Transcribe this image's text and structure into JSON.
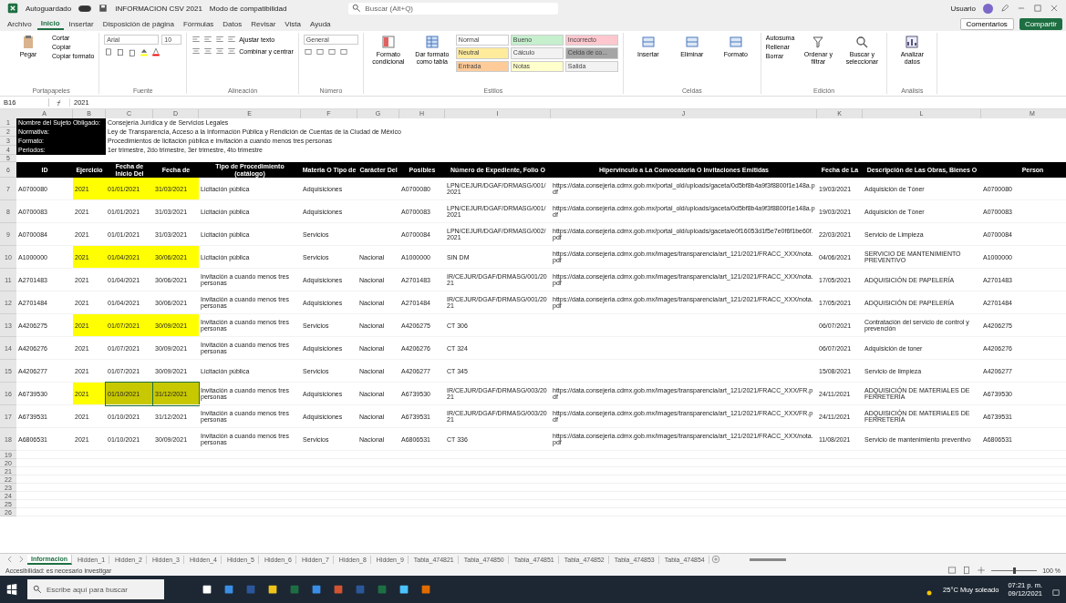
{
  "window": {
    "autosave": "Autoguardado",
    "autosave_on": true,
    "file": "INFORMACION CSV 2021",
    "mode": "Modo de compatibilidad",
    "search": "Buscar (Alt+Q)",
    "user": "Usuario"
  },
  "menu_tabs": [
    {
      "label": "Archivo",
      "selected": false
    },
    {
      "label": "Inicio",
      "selected": true
    },
    {
      "label": "Insertar",
      "selected": false
    },
    {
      "label": "Disposición de página",
      "selected": false
    },
    {
      "label": "Fórmulas",
      "selected": false
    },
    {
      "label": "Datos",
      "selected": false
    },
    {
      "label": "Revisar",
      "selected": false
    },
    {
      "label": "Vista",
      "selected": false
    },
    {
      "label": "Ayuda",
      "selected": false
    }
  ],
  "share": {
    "comments": "Comentarios",
    "share": "Compartir"
  },
  "ribbon": [
    {
      "kind": "clipboard",
      "label": "Portapapeles",
      "items": [
        "Pegar",
        "Cortar",
        "Copiar",
        "Copiar formato"
      ]
    },
    {
      "kind": "font",
      "label": "Fuente",
      "items": [
        "Arial",
        "10"
      ]
    },
    {
      "kind": "align",
      "label": "Alineación",
      "items": [
        "Ajustar texto",
        "Combinar y centrar"
      ]
    },
    {
      "kind": "number",
      "label": "Número",
      "items": [
        "General"
      ]
    },
    {
      "kind": "styles",
      "label": "Estilos",
      "items": [
        "Formato condicional",
        "Dar formato como tabla"
      ],
      "styles": [
        {
          "label": "Normal",
          "color": "#ffffff"
        },
        {
          "label": "Bueno",
          "color": "#c6efce"
        },
        {
          "label": "Incorrecto",
          "color": "#ffc7ce"
        },
        {
          "label": "Neutral",
          "color": "#ffeb9c"
        },
        {
          "label": "Cálculo",
          "color": "#f2f2f2"
        },
        {
          "label": "Celda de co...",
          "color": "#a5a5a5"
        },
        {
          "label": "Entrada",
          "color": "#ffcc99"
        },
        {
          "label": "Notas",
          "color": "#ffffcc"
        },
        {
          "label": "Salida",
          "color": "#f2f2f2"
        }
      ]
    },
    {
      "kind": "cells",
      "label": "Celdas",
      "items": [
        "Insertar",
        "Eliminar",
        "Formato"
      ]
    },
    {
      "kind": "edit",
      "label": "Edición",
      "items": [
        "Autosuma",
        "Rellenar",
        "Borrar",
        "Ordenar y filtrar",
        "Buscar y seleccionar"
      ]
    },
    {
      "kind": "analysis",
      "label": "Análisis",
      "items": [
        "Analizar datos"
      ]
    }
  ],
  "formula_bar": {
    "cell": "B16",
    "value": "2021"
  },
  "sheet": {
    "columns": [
      "A",
      "B",
      "C",
      "D",
      "E",
      "F",
      "G",
      "H",
      "I",
      "J",
      "K",
      "L",
      "M"
    ],
    "info": [
      {
        "row": "1",
        "label": "Nombre del Sujeto Obligado:",
        "value": "Consejería Jurídica y de Servicios Legales"
      },
      {
        "row": "2",
        "label": "Normativa:",
        "value": "Ley de Transparencia, Acceso a la Información Pública y Rendición de Cuentas de la Ciudad de México"
      },
      {
        "row": "3",
        "label": "Formato:",
        "value": "Procedimientos de licitación pública e invitación a cuando menos tres personas"
      },
      {
        "row": "4",
        "label": "Periodos:",
        "value": "1er trimestre, 2do trimestre, 3er trimestre, 4to trimestre"
      }
    ],
    "blank_row": "5",
    "header_row": "6",
    "headers": [
      "ID",
      "Ejercicio",
      "Fecha de Inicio Del",
      "Fecha de",
      "Tipo de Procedimiento (catálogo)",
      "Materia O Tipo de",
      "Carácter Del",
      "Posibles",
      "Número de Expediente, Folio O",
      "Hipervínculo a La Convocatoria O Invitaciones Emitidas",
      "Fecha de La",
      "Descripción de Las Obras, Bienes O",
      "Person"
    ],
    "rows": [
      {
        "row": "7",
        "highlight": true,
        "selected": false,
        "cells": [
          "A0700080",
          "2021",
          "01/01/2021",
          "31/03/2021",
          "Licitación pública",
          "Adquisiciones",
          "",
          "A0700080",
          "LPN/CEJUR/DGAF/DRMASG/001/2021",
          "https://data.consejeria.cdmx.gob.mx/portal_old/uploads/gaceta/0d5bf8b4a9f3f8800f1e148a.pdf",
          "19/03/2021",
          "Adquisición de Tóner",
          "A0700080"
        ]
      },
      {
        "row": "8",
        "highlight": false,
        "selected": false,
        "cells": [
          "A0700083",
          "2021",
          "01/01/2021",
          "31/03/2021",
          "Licitación pública",
          "Adquisiciones",
          "",
          "A0700083",
          "LPN/CEJUR/DGAF/DRMASG/001/2021",
          "https://data.consejeria.cdmx.gob.mx/portal_old/uploads/gaceta/0d5bf8b4a9f3f8800f1e148a.pdf",
          "19/03/2021",
          "Adquisición de Tóner",
          "A0700083"
        ]
      },
      {
        "row": "9",
        "highlight": false,
        "selected": false,
        "cells": [
          "A0700084",
          "2021",
          "01/01/2021",
          "31/03/2021",
          "Licitación pública",
          "Servicios",
          "",
          "A0700084",
          "LPN/CEJUR/DGAF/DRMASG/002/2021",
          "https://data.consejeria.cdmx.gob.mx/portal_old/uploads/gaceta/e0f16053d1f5e7e0f6f1be60f.pdf",
          "22/03/2021",
          "Servicio de Limpieza",
          "A0700084"
        ]
      },
      {
        "row": "10",
        "highlight": true,
        "selected": false,
        "cells": [
          "A1000000",
          "2021",
          "01/04/2021",
          "30/06/2021",
          "Licitación pública",
          "Servicios",
          "Nacional",
          "A1000000",
          "SIN DM",
          "https://data.consejeria.cdmx.gob.mx/images/transparencia/art_121/2021/FRACC_XXX/nota.pdf",
          "04/06/2021",
          "SERVICIO DE MANTENIMIENTO PREVENTIVO",
          "A1000000"
        ]
      },
      {
        "row": "11",
        "highlight": false,
        "selected": false,
        "cells": [
          "A2701483",
          "2021",
          "01/04/2021",
          "30/06/2021",
          "Invitación a cuando menos tres personas",
          "Adquisiciones",
          "Nacional",
          "A2701483",
          "IR/CEJUR/DGAF/DRMASG/001/2021",
          "https://data.consejeria.cdmx.gob.mx/images/transparencia/art_121/2021/FRACC_XXX/nota.pdf",
          "17/05/2021",
          "ADQUISICIÓN DE PAPELERÍA",
          "A2701483"
        ]
      },
      {
        "row": "12",
        "highlight": false,
        "selected": false,
        "cells": [
          "A2701484",
          "2021",
          "01/04/2021",
          "30/06/2021",
          "Invitación a cuando menos tres personas",
          "Adquisiciones",
          "Nacional",
          "A2701484",
          "IR/CEJUR/DGAF/DRMASG/001/2021",
          "https://data.consejeria.cdmx.gob.mx/images/transparencia/art_121/2021/FRACC_XXX/nota.pdf",
          "17/05/2021",
          "ADQUISICIÓN DE PAPELERÍA",
          "A2701484"
        ]
      },
      {
        "row": "13",
        "highlight": true,
        "selected": false,
        "cells": [
          "A4206275",
          "2021",
          "01/07/2021",
          "30/09/2021",
          "Invitación a cuando menos tres personas",
          "Servicios",
          "Nacional",
          "A4206275",
          "CT 306",
          "",
          "06/07/2021",
          "Contratación del servicio de control y prevención",
          "A4206275"
        ]
      },
      {
        "row": "14",
        "highlight": false,
        "selected": false,
        "cells": [
          "A4206276",
          "2021",
          "01/07/2021",
          "30/09/2021",
          "Invitación a cuando menos tres personas",
          "Adquisiciones",
          "Nacional",
          "A4206276",
          "CT 324",
          "",
          "06/07/2021",
          "Adquisición de toner",
          "A4206276"
        ]
      },
      {
        "row": "15",
        "highlight": false,
        "selected": false,
        "cells": [
          "A4206277",
          "2021",
          "01/07/2021",
          "30/09/2021",
          "Licitación pública",
          "Servicios",
          "Nacional",
          "A4206277",
          "CT 345",
          "",
          "15/08/2021",
          "Servicio de limpieza",
          "A4206277"
        ]
      },
      {
        "row": "16",
        "highlight": true,
        "selected": true,
        "cells": [
          "A6739530",
          "2021",
          "01/10/2021",
          "31/12/2021",
          "Invitación a cuando menos tres personas",
          "Adquisiciones",
          "Nacional",
          "A6739530",
          "IR/CEJUR/DGAF/DRMASG/003/2021",
          "https://data.consejeria.cdmx.gob.mx/images/transparencia/art_121/2021/FRACC_XXX/FR.pdf",
          "24/11/2021",
          "ADQUISICIÓN DE MATERIALES DE FERRETERÍA",
          "A6739530"
        ]
      },
      {
        "row": "17",
        "highlight": false,
        "selected": false,
        "cells": [
          "A6739531",
          "2021",
          "01/10/2021",
          "31/12/2021",
          "Invitación a cuando menos tres personas",
          "Adquisiciones",
          "Nacional",
          "A6739531",
          "IR/CEJUR/DGAF/DRMASG/003/2021",
          "https://data.consejeria.cdmx.gob.mx/images/transparencia/art_121/2021/FRACC_XXX/FR.pdf",
          "24/11/2021",
          "ADQUISICIÓN DE MATERIALES DE FERRETERÍA",
          "A6739531"
        ]
      },
      {
        "row": "18",
        "highlight": false,
        "selected": false,
        "cells": [
          "A6806531",
          "2021",
          "01/10/2021",
          "30/09/2021",
          "Invitación a cuando menos tres personas",
          "Servicios",
          "Nacional",
          "A6806531",
          "CT 336",
          "https://data.consejeria.cdmx.gob.mx/images/transparencia/art_121/2021/FRACC_XXX/nota.pdf",
          "11/08/2021",
          "Servicio de mantenimiento preventivo",
          "A6806531"
        ]
      }
    ],
    "empty_rows": [
      "19",
      "20",
      "21",
      "22",
      "23",
      "24",
      "25",
      "26"
    ]
  },
  "sheet_tabs": [
    {
      "label": "Informacion",
      "selected": true
    },
    {
      "label": "Hidden_1",
      "selected": false
    },
    {
      "label": "Hidden_2",
      "selected": false
    },
    {
      "label": "Hidden_3",
      "selected": false
    },
    {
      "label": "Hidden_4",
      "selected": false
    },
    {
      "label": "Hidden_5",
      "selected": false
    },
    {
      "label": "Hidden_6",
      "selected": false
    },
    {
      "label": "Hidden_7",
      "selected": false
    },
    {
      "label": "Hidden_8",
      "selected": false
    },
    {
      "label": "Hidden_9",
      "selected": false
    },
    {
      "label": "Tabla_474821",
      "selected": false
    },
    {
      "label": "Tabla_474850",
      "selected": false
    },
    {
      "label": "Tabla_474851",
      "selected": false
    },
    {
      "label": "Tabla_474852",
      "selected": false
    },
    {
      "label": "Tabla_474853",
      "selected": false
    },
    {
      "label": "Tabla_474854",
      "selected": false
    }
  ],
  "status_bar": {
    "text": "Accesibilidad: es necesario investigar",
    "zoom": "100 %",
    "zoom_slider": {
      "level": 0.5
    }
  },
  "taskbar": {
    "search": "Escribe aquí para buscar",
    "weather": "25°C Muy soleado",
    "time": "07:21 p. m.",
    "date": "09/12/2021"
  }
}
